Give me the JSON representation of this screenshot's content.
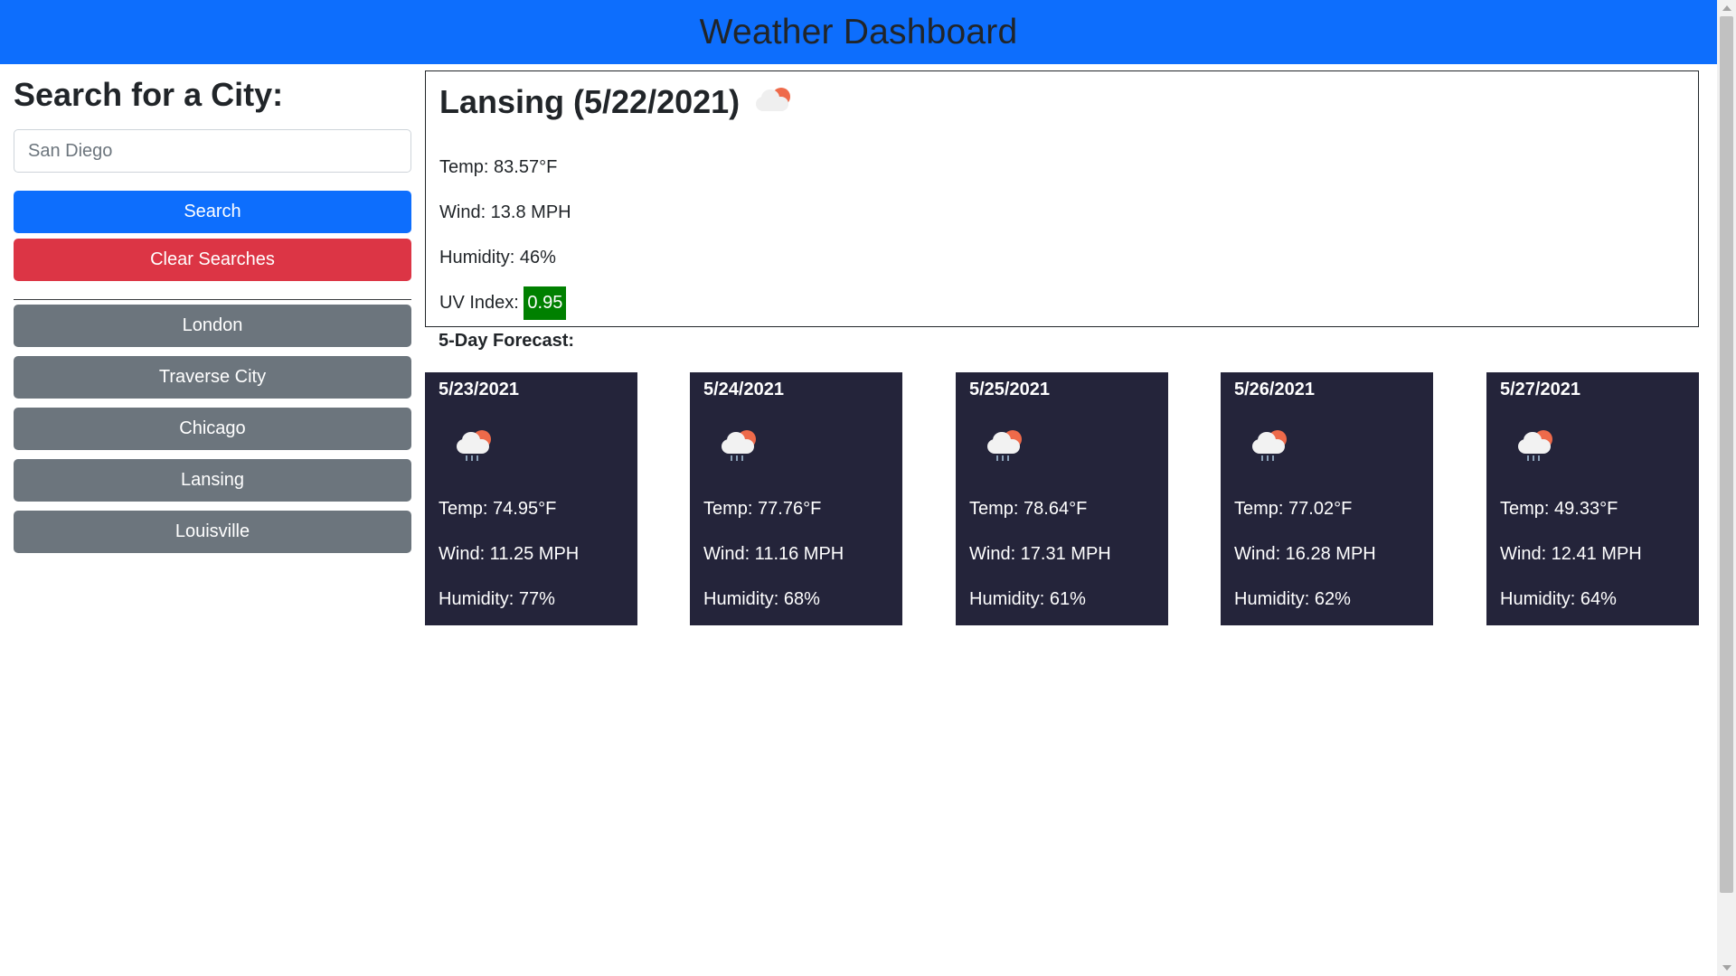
{
  "header": {
    "title": "Weather Dashboard"
  },
  "sidebar": {
    "heading": "Search for a City:",
    "search": {
      "value": "",
      "placeholder": "San Diego"
    },
    "search_button": "Search",
    "clear_button": "Clear Searches",
    "history": [
      "London",
      "Traverse City",
      "Chicago",
      "Lansing",
      "Louisville"
    ]
  },
  "current": {
    "title": "Lansing (5/22/2021)",
    "icon": "partly-cloudy-icon",
    "temp": "Temp: 83.57°F",
    "wind": "Wind: 13.8 MPH",
    "humidity": "Humidity: 46%",
    "uv_label": "UV Index:",
    "uv_value": "0.95",
    "uv_color": "#008000"
  },
  "forecast": {
    "label": "5-Day Forecast:",
    "days": [
      {
        "date": "5/23/2021",
        "icon": "rain-cloud-sun-icon",
        "temp": "Temp: 74.95°F",
        "wind": "Wind: 11.25 MPH",
        "humidity": "Humidity: 77%"
      },
      {
        "date": "5/24/2021",
        "icon": "rain-cloud-sun-icon",
        "temp": "Temp: 77.76°F",
        "wind": "Wind: 11.16 MPH",
        "humidity": "Humidity: 68%"
      },
      {
        "date": "5/25/2021",
        "icon": "rain-cloud-sun-icon",
        "temp": "Temp: 78.64°F",
        "wind": "Wind: 17.31 MPH",
        "humidity": "Humidity: 61%"
      },
      {
        "date": "5/26/2021",
        "icon": "rain-cloud-sun-icon",
        "temp": "Temp: 77.02°F",
        "wind": "Wind: 16.28 MPH",
        "humidity": "Humidity: 62%"
      },
      {
        "date": "5/27/2021",
        "icon": "rain-cloud-sun-icon",
        "temp": "Temp: 49.33°F",
        "wind": "Wind: 12.41 MPH",
        "humidity": "Humidity: 64%"
      }
    ]
  },
  "colors": {
    "primary": "#0d6efd",
    "danger": "#dc3545",
    "secondary": "#6c757d",
    "card_bg": "#24243a"
  }
}
